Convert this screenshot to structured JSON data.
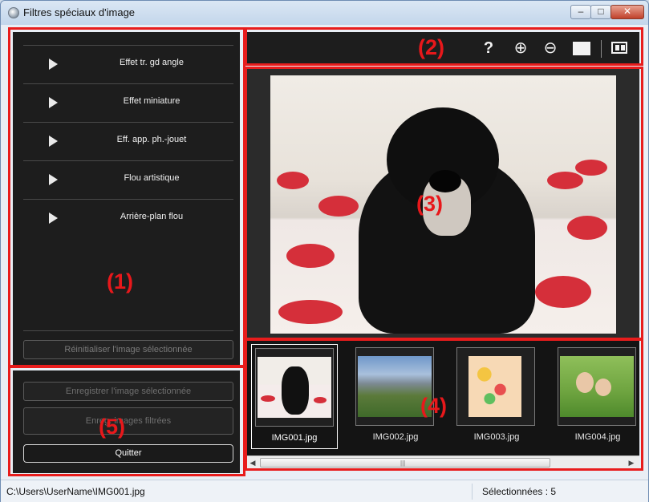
{
  "window": {
    "title": "Filtres spéciaux d'image"
  },
  "effects": {
    "items": [
      {
        "label": "Effet tr. gd angle"
      },
      {
        "label": "Effet miniature"
      },
      {
        "label": "Eff. app. ph.-jouet"
      },
      {
        "label": "Flou artistique"
      },
      {
        "label": "Arrière-plan flou"
      }
    ],
    "reset_label": "Réinitialiser l'image sélectionnée"
  },
  "actions": {
    "save_selected_label": "Enregistrer l'image sélectionnée",
    "save_filtered_label": "Enreg. images filtrées",
    "quit_label": "Quitter"
  },
  "toolbar": {
    "help_icon": "help-icon",
    "zoom_in_icon": "zoom-in-icon",
    "zoom_out_icon": "zoom-out-icon",
    "full_view_icon": "full-screen-icon",
    "compare_icon": "compare-view-icon"
  },
  "filmstrip": {
    "thumbnails": [
      {
        "filename": "IMG001.jpg",
        "selected": true
      },
      {
        "filename": "IMG002.jpg",
        "selected": false
      },
      {
        "filename": "IMG003.jpg",
        "selected": false
      },
      {
        "filename": "IMG004.jpg",
        "selected": false
      }
    ]
  },
  "status": {
    "path": "C:\\Users\\UserName\\IMG001.jpg",
    "selected_count": "Sélectionnées : 5"
  },
  "callouts": [
    "(1)",
    "(2)",
    "(3)",
    "(4)",
    "(5)"
  ],
  "colors": {
    "callout": "#e81c1c",
    "panel": "#1d1d1d"
  }
}
